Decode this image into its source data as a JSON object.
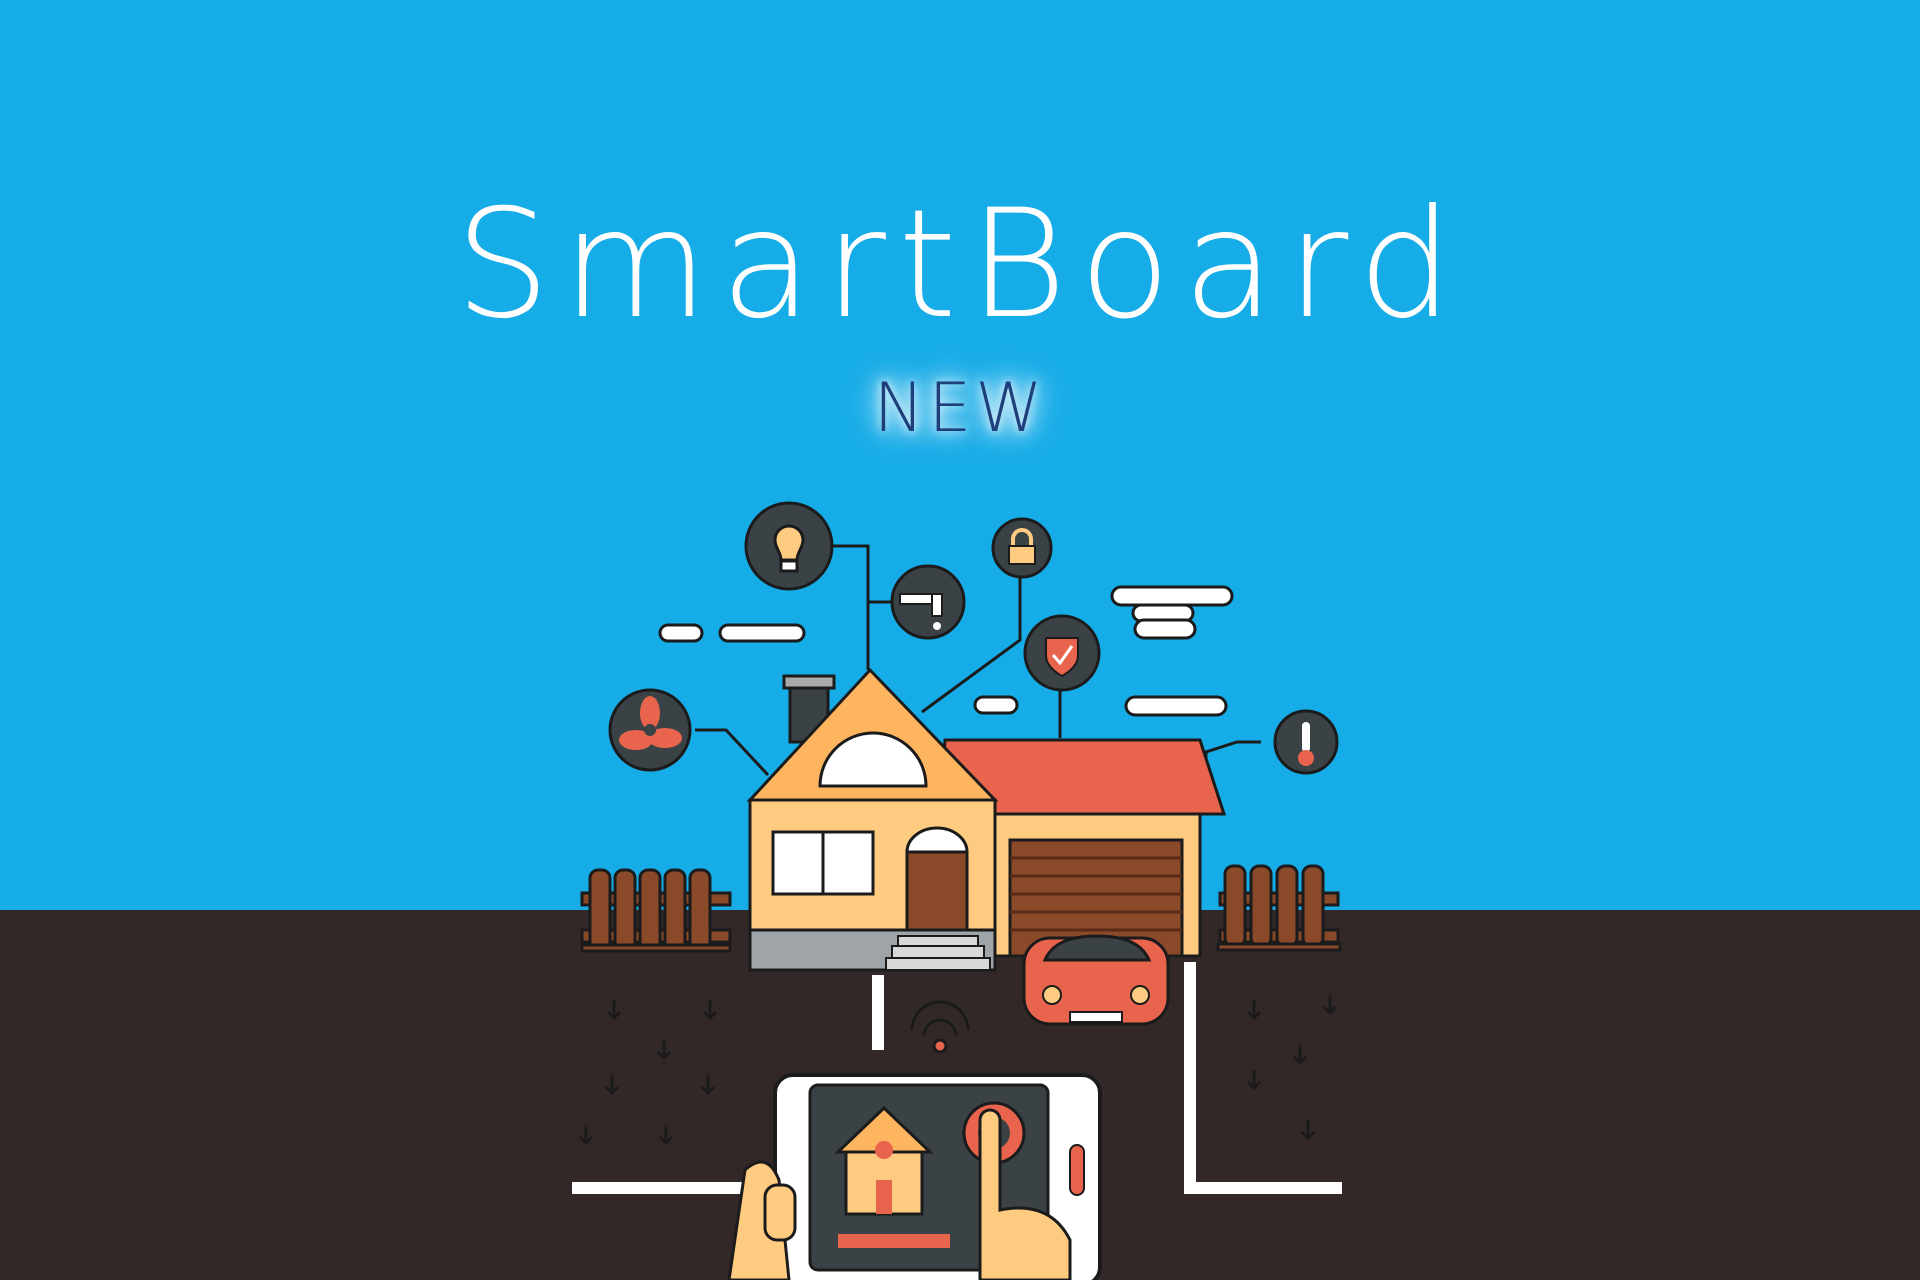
{
  "banner": {
    "title": "SmartBoard",
    "badge": "NEW"
  },
  "colors": {
    "sky": "#16ACE8",
    "ground": "#322828",
    "house_wall": "#FFCB80",
    "roof": "#E8644C",
    "outline": "#1B1B1B",
    "icon_circle": "#3B4246",
    "fence": "#8A4A2A"
  },
  "smart_icons": [
    "bulb-icon",
    "faucet-icon",
    "lock-icon",
    "shield-icon",
    "fan-icon",
    "thermometer-icon",
    "wifi-icon"
  ]
}
